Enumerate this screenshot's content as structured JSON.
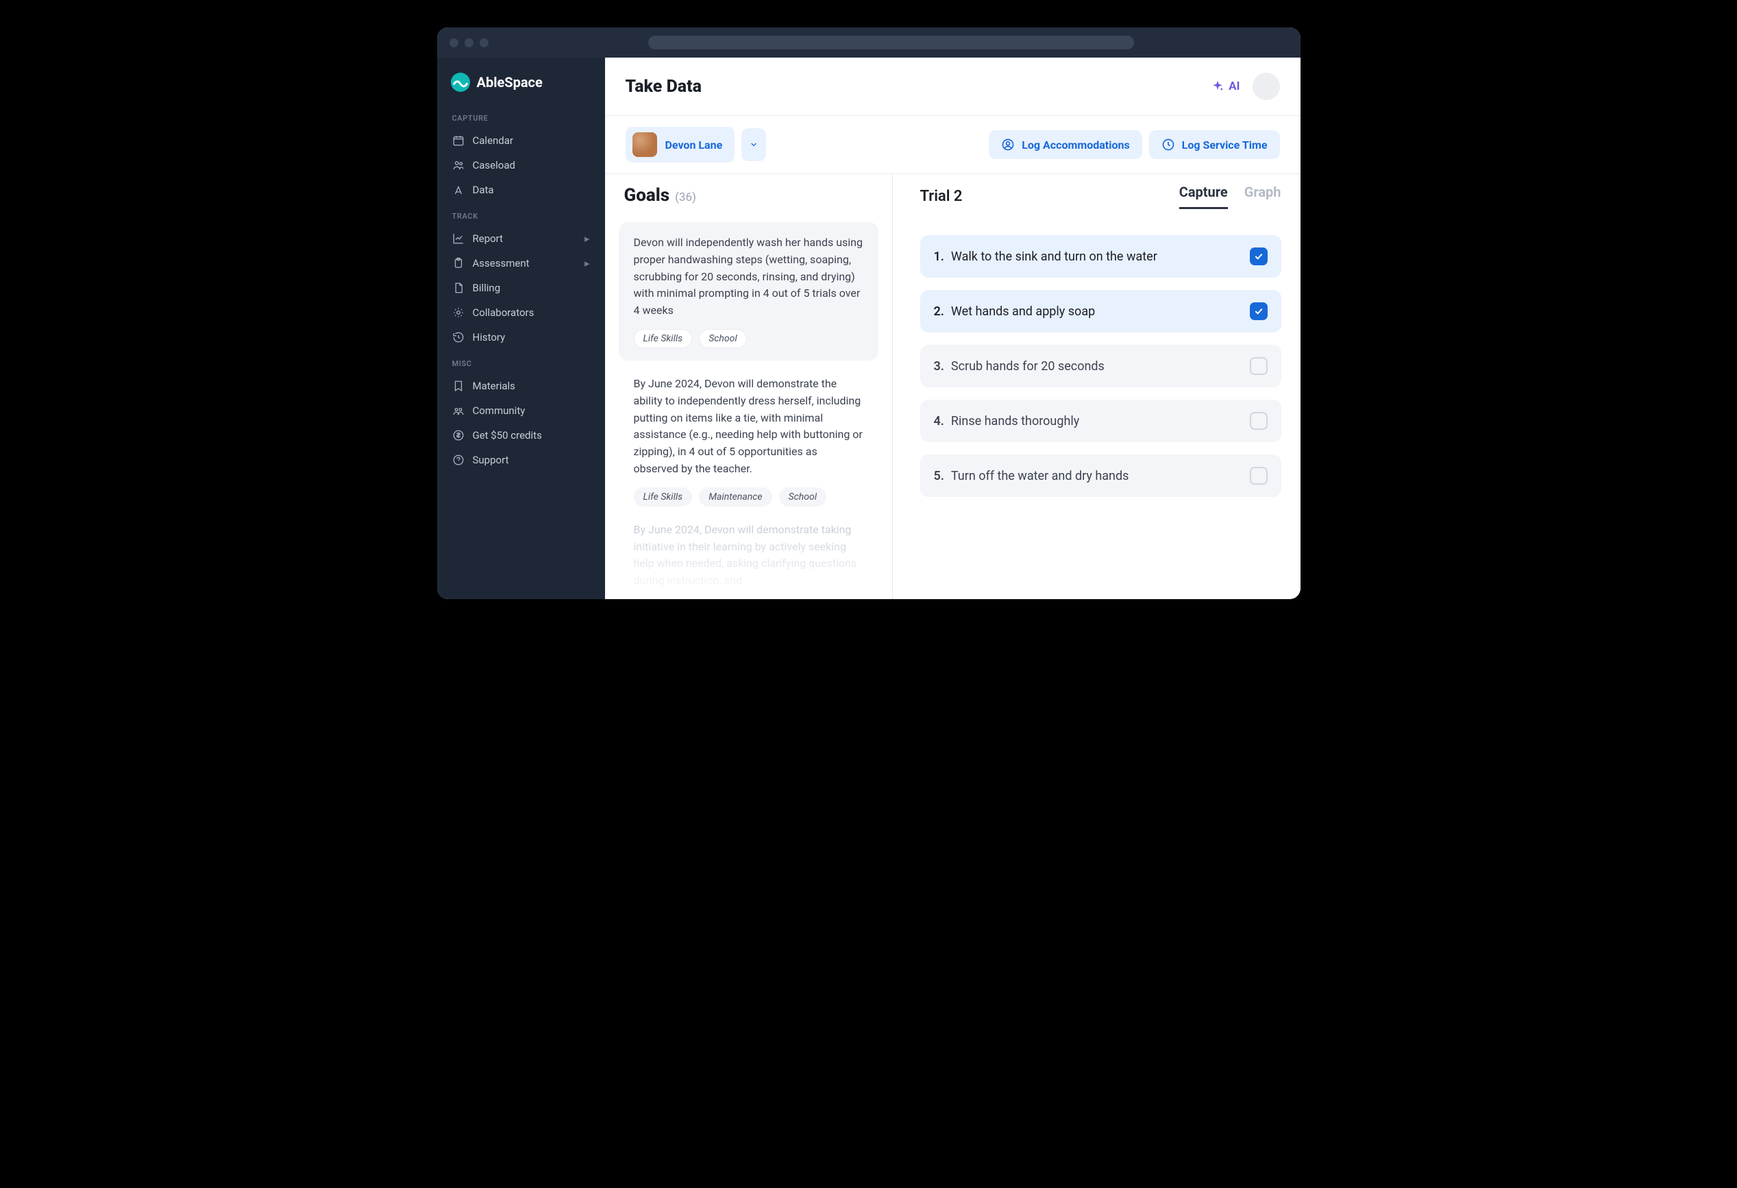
{
  "brand": {
    "name": "AbleSpace"
  },
  "sidebar": {
    "sections": {
      "capture": {
        "label": "CAPTURE",
        "items": [
          {
            "label": "Calendar"
          },
          {
            "label": "Caseload"
          },
          {
            "label": "Data"
          }
        ]
      },
      "track": {
        "label": "TRACK",
        "items": [
          {
            "label": "Report",
            "hasSub": true
          },
          {
            "label": "Assessment",
            "hasSub": true
          },
          {
            "label": "Billing"
          },
          {
            "label": "Collaborators"
          },
          {
            "label": "History"
          }
        ]
      },
      "misc": {
        "label": "MISC",
        "items": [
          {
            "label": "Materials"
          },
          {
            "label": "Community"
          },
          {
            "label": "Get $50 credits"
          },
          {
            "label": "Support"
          }
        ]
      }
    }
  },
  "header": {
    "title": "Take Data",
    "aiLabel": "AI"
  },
  "toolbar": {
    "studentName": "Devon Lane",
    "logAccommodations": "Log Accommodations",
    "logServiceTime": "Log Service Time"
  },
  "goals": {
    "title": "Goals",
    "count": "(36)",
    "items": [
      {
        "text": "Devon will independently wash her hands using proper handwashing steps (wetting, soaping, scrubbing for 20 seconds, rinsing, and drying) with minimal prompting in 4 out of 5 trials over 4 weeks",
        "tags": [
          "Life Skills",
          "School"
        ],
        "card": true
      },
      {
        "text": "By June 2024, Devon will demonstrate the ability to independently dress herself, including putting on items like a tie, with minimal assistance (e.g., needing help with buttoning or zipping), in 4 out of 5 opportunities as observed by the teacher.",
        "tags": [
          "Life Skills",
          "Maintenance",
          "School"
        ],
        "card": false
      },
      {
        "text": "By June 2024, Devon will demonstrate taking initiative in their learning by actively seeking help when needed, asking clarifying questions during instruction, and",
        "tags": [],
        "faded": true,
        "card": false
      }
    ]
  },
  "trial": {
    "label": "Trial 2",
    "tabs": {
      "capture": "Capture",
      "graph": "Graph",
      "active": "capture"
    },
    "steps": [
      {
        "num": "1.",
        "text": "Walk to the sink and turn on the water",
        "done": true
      },
      {
        "num": "2.",
        "text": "Wet hands and apply soap",
        "done": true
      },
      {
        "num": "3.",
        "text": "Scrub hands for 20 seconds",
        "done": false
      },
      {
        "num": "4.",
        "text": "Rinse hands thoroughly",
        "done": false
      },
      {
        "num": "5.",
        "text": "Turn off the water and dry hands",
        "done": false
      }
    ]
  }
}
